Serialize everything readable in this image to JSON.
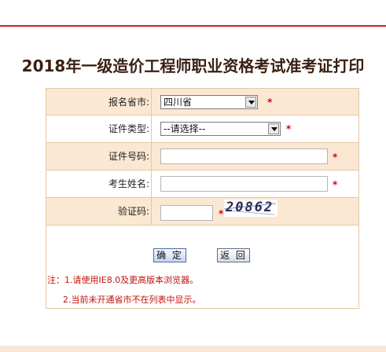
{
  "page": {
    "title": "2018年一级造价工程师职业资格考试准考证打印"
  },
  "form": {
    "province": {
      "label": "报名省市:",
      "value": "四川省",
      "required": "*"
    },
    "id_type": {
      "label": "证件类型:",
      "value": "--请选择--",
      "required": "*"
    },
    "id_number": {
      "label": "证件号码:",
      "value": "",
      "placeholder": "",
      "required": "*"
    },
    "name": {
      "label": "考生姓名:",
      "value": "",
      "placeholder": "",
      "required": "*"
    },
    "captcha": {
      "label": "验证码:",
      "value": "",
      "placeholder": "",
      "required": "*",
      "image_text": "20862"
    }
  },
  "buttons": {
    "confirm": "确 定",
    "back": "返 回"
  },
  "notes": {
    "line1": "注：1.请使用IE8.0及更高版本浏览器。",
    "line2": "2.当前未开通省市不在列表中显示。"
  },
  "colors": {
    "accent": "#c0262d",
    "row_shade": "#fbe8d2",
    "border": "#e6c7a4",
    "required": "#d0021b"
  }
}
